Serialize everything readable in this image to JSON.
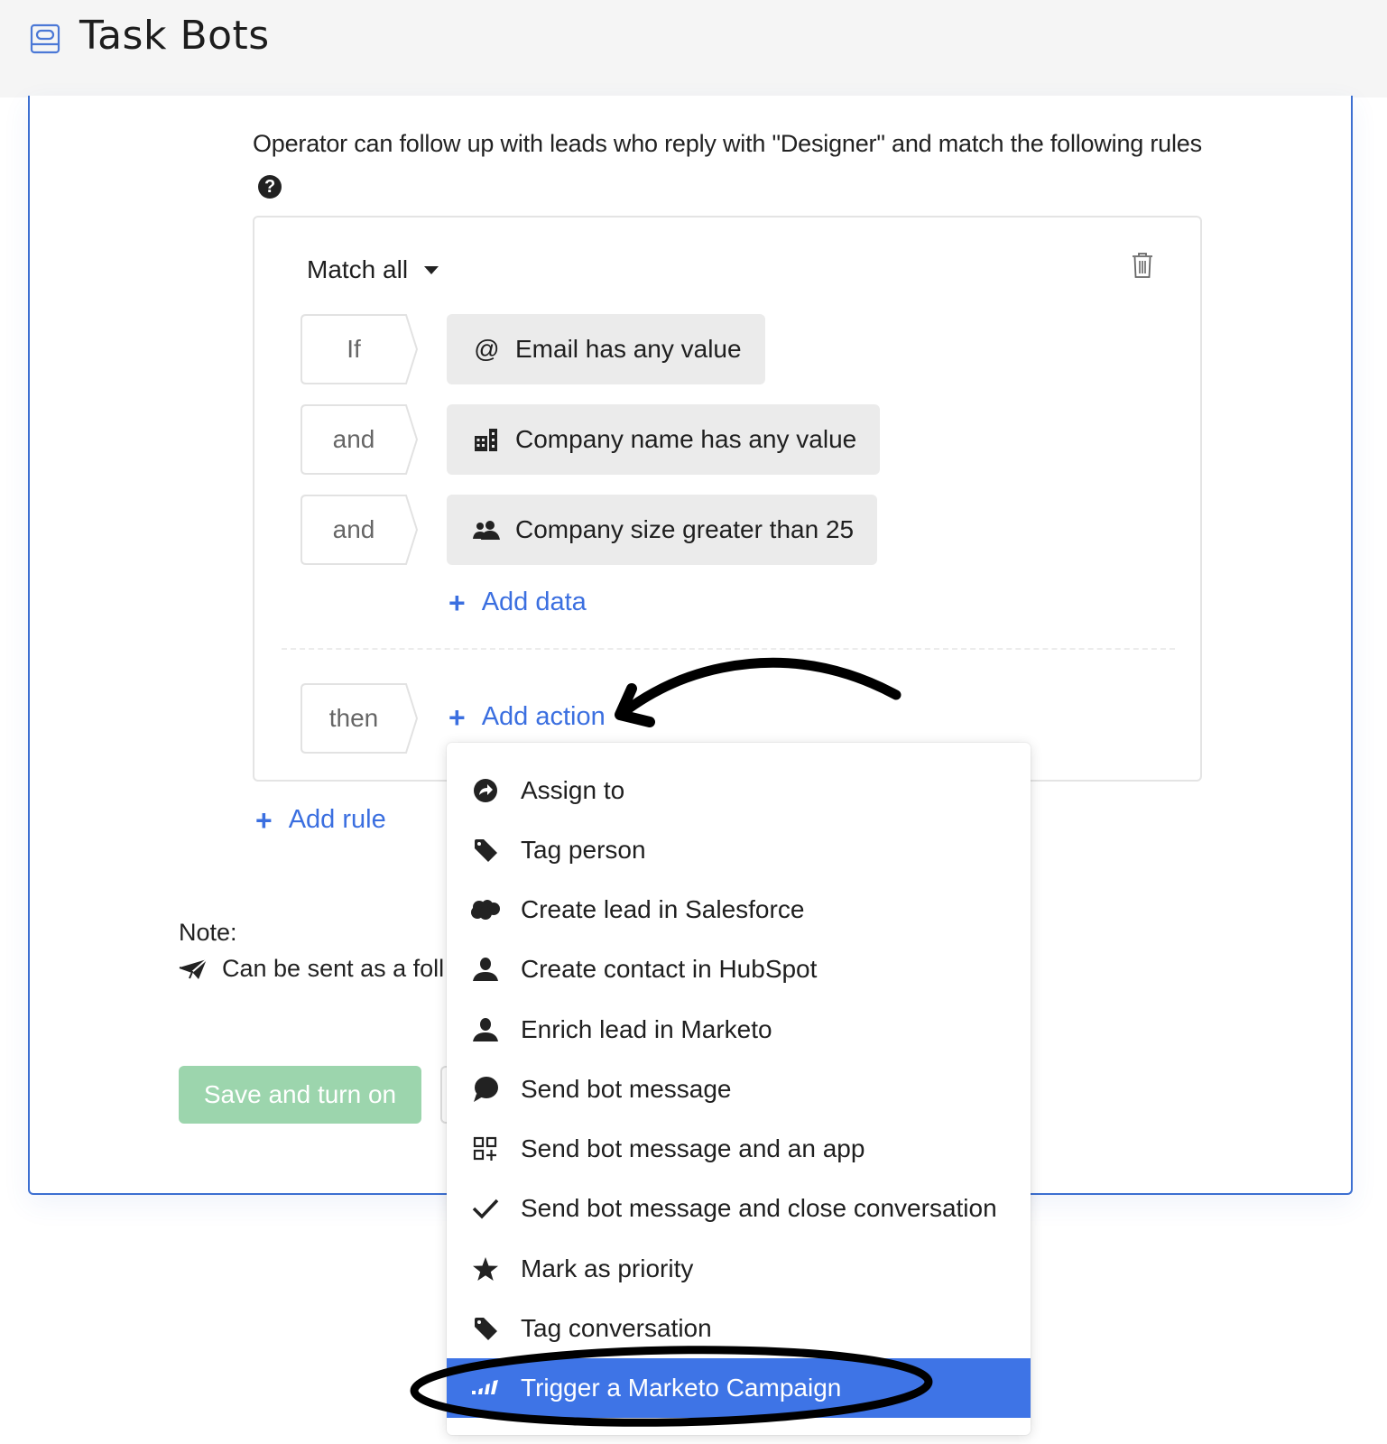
{
  "header": {
    "title": "Task Bots",
    "icon": "bot-list-icon"
  },
  "intro": {
    "text": "Operator can follow up with leads who reply with \"Designer\" and match the following rules",
    "help_icon": "question-circle-icon"
  },
  "rule": {
    "match_selector": {
      "selected": "Match all"
    },
    "delete_icon": "trash-icon",
    "conditions": [
      {
        "connector": "If",
        "icon": "at-sign-icon",
        "label": "Email has any value"
      },
      {
        "connector": "and",
        "icon": "building-icon",
        "label": "Company name has any value"
      },
      {
        "connector": "and",
        "icon": "users-icon",
        "label": "Company size greater than 25"
      }
    ],
    "add_data_label": "Add data",
    "then_label": "then",
    "add_action_label": "Add action"
  },
  "add_rule_label": "Add rule",
  "note": {
    "title": "Note:",
    "text": "Can be sent as a foll",
    "icon": "paper-plane-icon"
  },
  "buttons": {
    "save": "Save and turn on"
  },
  "colors": {
    "accent": "#3b6fe0",
    "card_border": "#3c6fd1",
    "menu_active": "#3e74e6",
    "save_button": "#9cd5ad",
    "condition_bg": "#ebebeb",
    "header_bg": "#f5f5f5"
  },
  "action_menu": {
    "items": [
      {
        "icon": "assign-arrow-icon",
        "label": "Assign to"
      },
      {
        "icon": "tag-icon",
        "label": "Tag person"
      },
      {
        "icon": "salesforce-cloud-icon",
        "label": "Create lead in Salesforce"
      },
      {
        "icon": "person-icon",
        "label": "Create contact in HubSpot"
      },
      {
        "icon": "person-icon",
        "label": "Enrich lead in Marketo"
      },
      {
        "icon": "chat-bubble-icon",
        "label": "Send bot message"
      },
      {
        "icon": "app-grid-icon",
        "label": "Send bot message and an app"
      },
      {
        "icon": "checkmark-icon",
        "label": "Send bot message and close conversation"
      },
      {
        "icon": "star-icon",
        "label": "Mark as priority"
      },
      {
        "icon": "tag-icon",
        "label": "Tag conversation"
      },
      {
        "icon": "marketo-icon",
        "label": "Trigger a Marketo Campaign",
        "active": true
      }
    ]
  }
}
